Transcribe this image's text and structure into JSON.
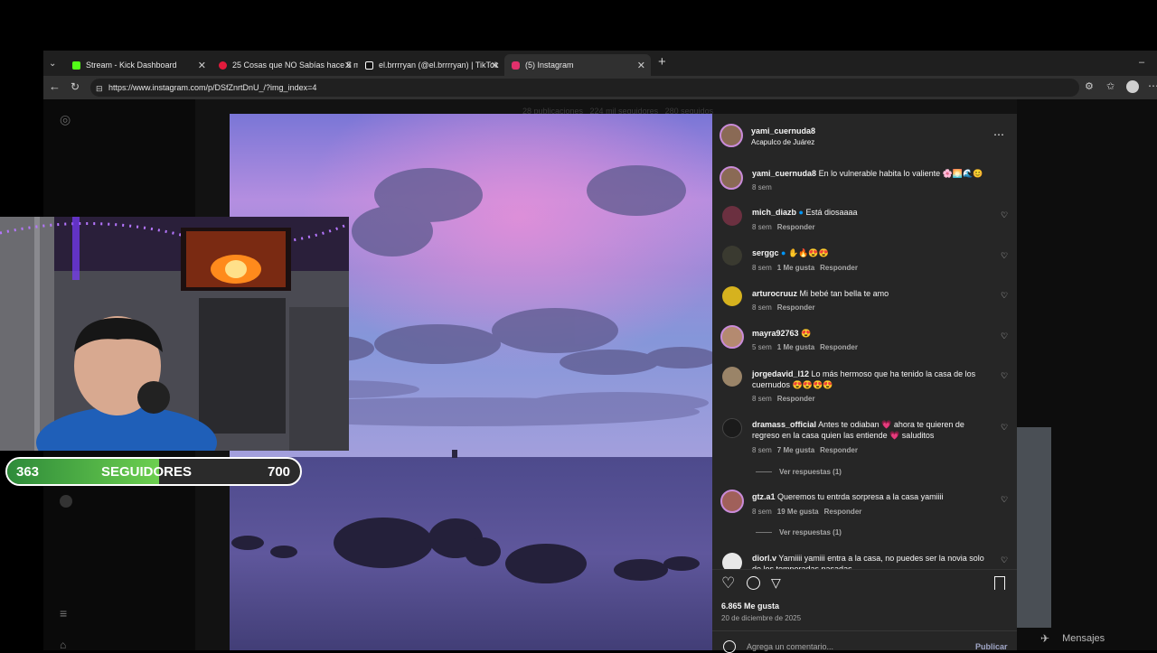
{
  "browser": {
    "tabs": [
      {
        "title": "Stream - Kick Dashboard",
        "active": false,
        "color": "#53fc18"
      },
      {
        "title": "25 Cosas que NO Sabías hace 5 m",
        "active": false,
        "color": "#e21b3c"
      },
      {
        "title": "el.brrrryan (@el.brrrryan) | TikTok",
        "active": false,
        "color": "#ffffff"
      },
      {
        "title": "(5) Instagram",
        "active": true,
        "color": "#e1306c"
      }
    ],
    "url": "https://www.instagram.com/p/DSfZnrtDnU_/?img_index=4"
  },
  "profile_bg": {
    "stats": "28 publicaciones   224 mil seguidores   280 seguidos"
  },
  "post": {
    "username": "yami_cuernuda8",
    "location": "Acapulco de Juárez",
    "caption_user": "yami_cuernuda8",
    "caption_text": "En lo vulnerable habita lo valiente 🌸🌅🌊😊",
    "caption_time": "8 sem",
    "comments": [
      {
        "user": "mich_diazb",
        "text": "Está diosaaaa",
        "verified": true,
        "time": "8 sem",
        "likes": "",
        "reply": "Responder",
        "replies": ""
      },
      {
        "user": "serggc",
        "text": "✋🔥😍😍",
        "verified": true,
        "time": "8 sem",
        "likes": "1 Me gusta",
        "reply": "Responder",
        "replies": ""
      },
      {
        "user": "arturocruuz",
        "text": "Mi bebé tan bella te amo",
        "verified": false,
        "time": "8 sem",
        "likes": "",
        "reply": "Responder",
        "replies": ""
      },
      {
        "user": "mayra92763",
        "text": "😍",
        "verified": false,
        "time": "5 sem",
        "likes": "1 Me gusta",
        "reply": "Responder",
        "replies": ""
      },
      {
        "user": "jorgedavid_l12",
        "text": "Lo más hermoso que ha tenido la casa de los cuernudos 😍😍😍😍",
        "verified": false,
        "time": "8 sem",
        "likes": "",
        "reply": "Responder",
        "replies": ""
      },
      {
        "user": "dramass_official",
        "text": "Antes te odiaban 💗 ahora te quieren de regreso en la casa quien las entiende 💗 saluditos",
        "verified": false,
        "time": "8 sem",
        "likes": "7 Me gusta",
        "reply": "Responder",
        "replies": "Ver respuestas (1)"
      },
      {
        "user": "gtz.a1",
        "text": "Queremos tu entrda sorpresa a la casa yamiiii",
        "verified": false,
        "time": "8 sem",
        "likes": "19 Me gusta",
        "reply": "Responder",
        "replies": "Ver respuestas (1)"
      },
      {
        "user": "diorl.v",
        "text": "Yamiiii yamiii entra a la casa, no puedes ser la novia solo de los temporadas pasadas",
        "verified": false,
        "time": "",
        "likes": "",
        "reply": "",
        "replies": ""
      }
    ],
    "likes": "6.865 Me gusta",
    "date": "20 de diciembre de 2025",
    "comment_placeholder": "Agrega un comentario...",
    "publish_label": "Publicar"
  },
  "messages_label": "Mensajes",
  "overlay": {
    "current": "363",
    "label": "SEGUIDORES",
    "goal": "700",
    "progress": 0.52
  },
  "colors": {
    "bar_fill": "#53fc18",
    "verified": "#0095f6",
    "panel_bg": "#262626"
  }
}
